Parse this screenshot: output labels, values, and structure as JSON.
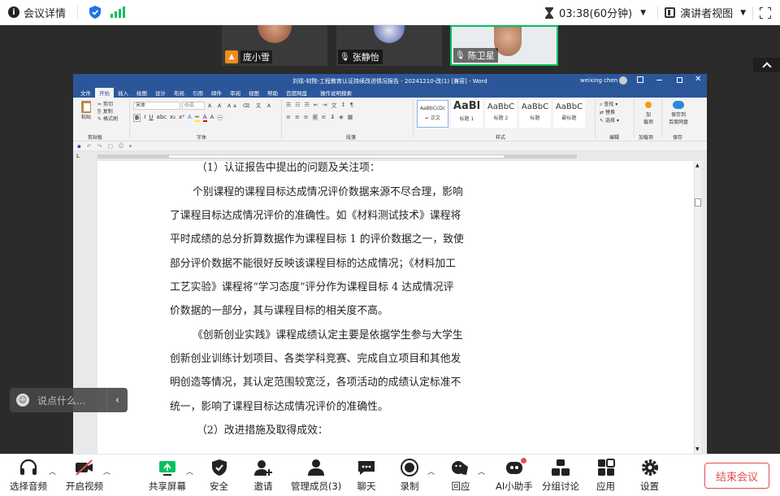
{
  "topbar": {
    "meeting_details": "会议详情",
    "timer": "03:38(60分钟)",
    "speaker_view": "演讲者视图"
  },
  "participants": [
    {
      "name": "庞小雪",
      "mic": "off-video"
    },
    {
      "name": "张静怡",
      "mic": "on"
    },
    {
      "name": "陈卫星",
      "mic": "on",
      "active": true
    }
  ],
  "word": {
    "title": "刘瑶-材院-工程教育认证持续改进情况报告 - 20241210-改(1) [兼容] - Word",
    "user": "weixing chen",
    "tabs": [
      "文件",
      "开始",
      "插入",
      "绘图",
      "设计",
      "布局",
      "引用",
      "邮件",
      "审阅",
      "视图",
      "帮助",
      "百度网盘",
      "操作说明搜索"
    ],
    "active_tab": "开始",
    "ribbon": {
      "paste": "粘贴",
      "cut": "剪切",
      "copy": "复制",
      "format_painter": "格式刷",
      "clipboard": "剪贴板",
      "font_name": "宋体",
      "font_size": "小三",
      "font_group": "字体",
      "paragraph_group": "段落",
      "styles": [
        {
          "preview": "AaBbCcDc",
          "name": "↵ 正文"
        },
        {
          "preview": "AaBl",
          "name": "标题 1"
        },
        {
          "preview": "AaBbC",
          "name": "标题 2"
        },
        {
          "preview": "AaBbC",
          "name": "标题"
        },
        {
          "preview": "AaBbC",
          "name": "副标题"
        }
      ],
      "styles_group": "样式",
      "find": "查找",
      "replace": "替换",
      "select": "选择",
      "editing_group": "编辑",
      "addin_label": "加\n载项",
      "addins_group": "加载项",
      "save_baidu": "保存到\n百度网盘",
      "save_group": "保存"
    },
    "doc": [
      "（1）认证报告中提出的问题及关注项：",
      "个别课程的课程目标达成情况评价数据来源不尽合理，影响",
      "了课程目标达成情况评价的准确性。如《材料测试技术》课程将",
      "平时成绩的总分折算数据作为课程目标 1 的评价数据之一，致使",
      "部分评价数据不能很好反映该课程目标的达成情况；《材料加工",
      "工艺实验》课程将“学习态度”评分作为课程目标 4 达成情况评",
      "价数据的一部分，其与课程目标的相关度不高。",
      "《创新创业实践》课程成绩认定主要是依据学生参与大学生",
      "创新创业训练计划项目、各类学科竞赛、完成自立项目和其他发",
      "明创造等情况，其认定范围较宽泛，各项活动的成绩认定标准不",
      "统一，影响了课程目标达成情况评价的准确性。",
      "（2）改进措施及取得成效："
    ]
  },
  "chat_placeholder": "说点什么...",
  "toolbar": [
    {
      "label": "选择音频",
      "icon": "headset-icon"
    },
    {
      "label": "开启视频",
      "icon": "video-off-icon"
    },
    {
      "label": "共享屏幕",
      "icon": "share-screen-icon"
    },
    {
      "label": "安全",
      "icon": "shield-icon"
    },
    {
      "label": "邀请",
      "icon": "invite-icon"
    },
    {
      "label": "管理成员(3)",
      "icon": "members-icon"
    },
    {
      "label": "聊天",
      "icon": "chat-icon"
    },
    {
      "label": "录制",
      "icon": "record-icon"
    },
    {
      "label": "回应",
      "icon": "reaction-icon"
    },
    {
      "label": "AI小助手",
      "icon": "ai-assistant-icon"
    },
    {
      "label": "分组讨论",
      "icon": "breakout-icon"
    },
    {
      "label": "应用",
      "icon": "apps-icon"
    },
    {
      "label": "设置",
      "icon": "gear-icon"
    }
  ],
  "end_meeting": "结束会议",
  "colors": {
    "accent_green": "#07c160",
    "word_blue": "#2b579a",
    "end_red": "#e34d4d",
    "shield_blue": "#1e73e8"
  }
}
